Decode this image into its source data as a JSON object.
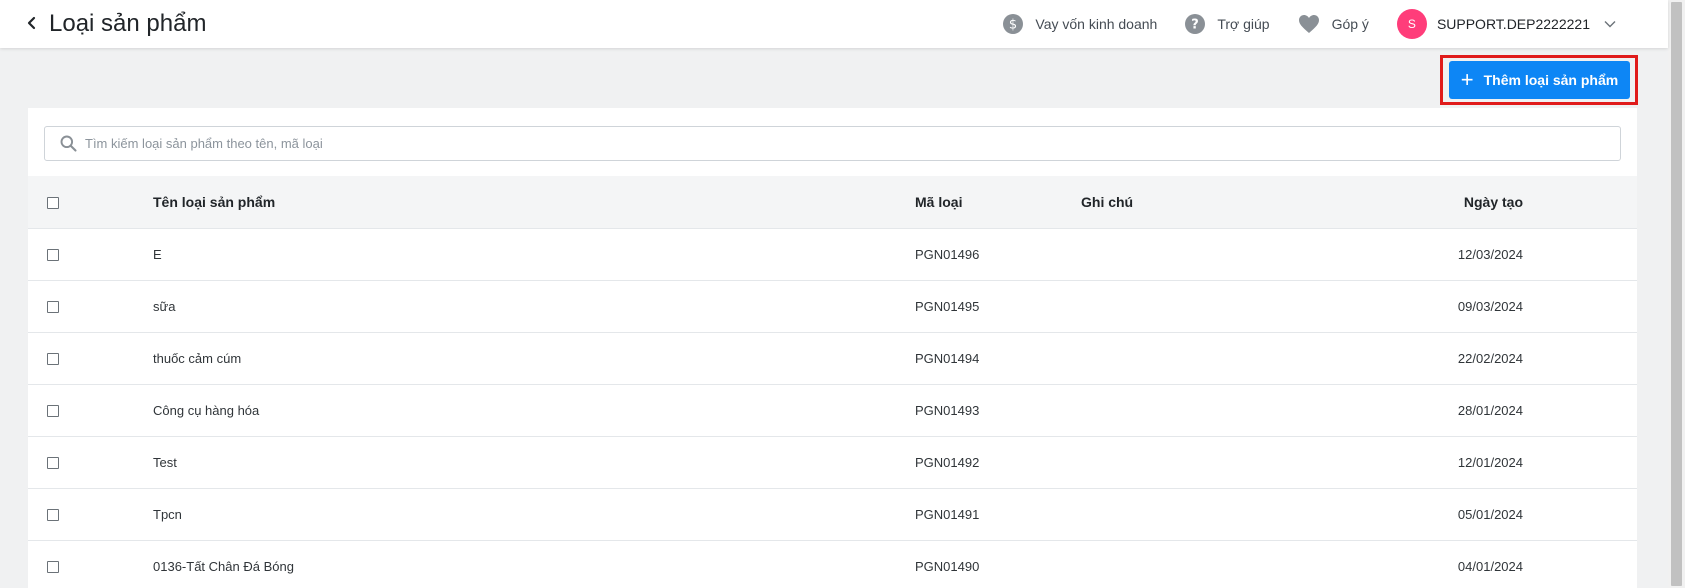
{
  "header": {
    "title": "Loại sản phẩm",
    "nav": {
      "loan": "Vay vốn kinh doanh",
      "help": "Trợ giúp",
      "feedback": "Góp ý"
    },
    "user": {
      "initial": "S",
      "name": "SUPPORT.DEP2222221"
    }
  },
  "toolbar": {
    "add_label": "Thêm loại sản phẩm"
  },
  "search": {
    "placeholder": "Tìm kiếm loại sản phẩm theo tên, mã loại"
  },
  "table": {
    "columns": {
      "name": "Tên loại sản phẩm",
      "code": "Mã loại",
      "note": "Ghi chú",
      "date": "Ngày tạo"
    },
    "rows": [
      {
        "name": "E",
        "code": "PGN01496",
        "note": "",
        "date": "12/03/2024"
      },
      {
        "name": "sữa",
        "code": "PGN01495",
        "note": "",
        "date": "09/03/2024"
      },
      {
        "name": "thuốc cảm cúm",
        "code": "PGN01494",
        "note": "",
        "date": "22/02/2024"
      },
      {
        "name": "Công cụ hàng hóa",
        "code": "PGN01493",
        "note": "",
        "date": "28/01/2024"
      },
      {
        "name": "Test",
        "code": "PGN01492",
        "note": "",
        "date": "12/01/2024"
      },
      {
        "name": "Tpcn",
        "code": "PGN01491",
        "note": "",
        "date": "05/01/2024"
      },
      {
        "name": "0136-Tất Chân Đá Bóng",
        "code": "PGN01490",
        "note": "",
        "date": "04/01/2024"
      }
    ]
  },
  "colors": {
    "primary": "#0d86f5",
    "annotation_red": "#e01b1b",
    "avatar": "#ff3d7a",
    "icon_gray": "#8a9096"
  }
}
